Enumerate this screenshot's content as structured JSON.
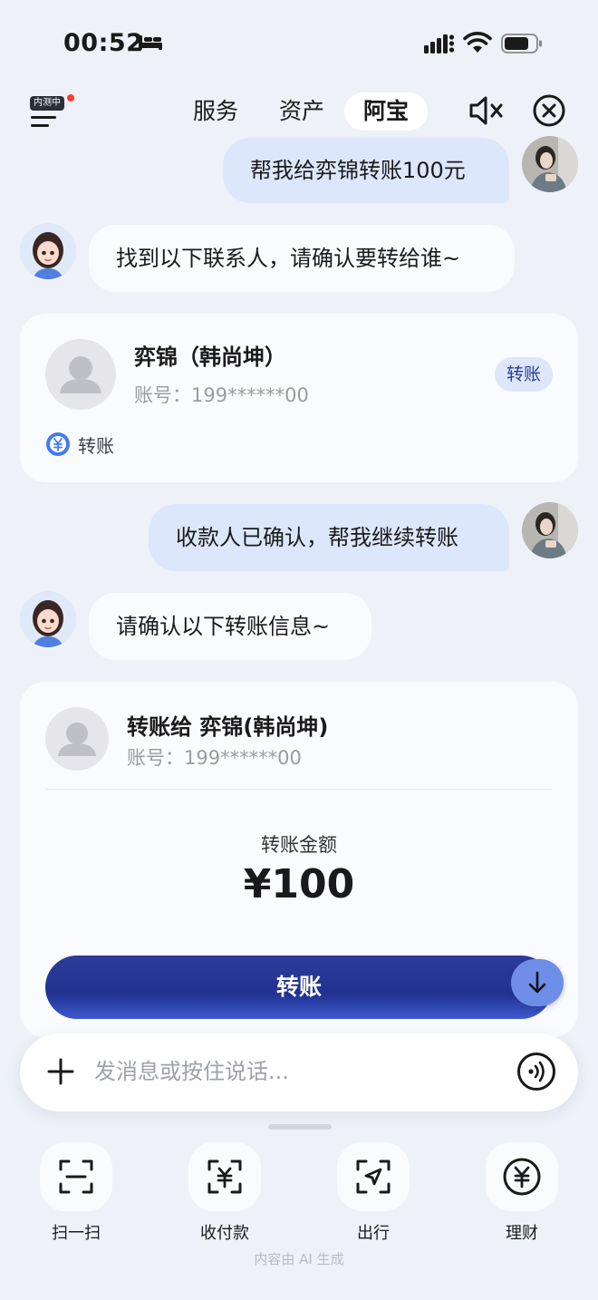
{
  "status_bar": {
    "time": "00:52"
  },
  "nav": {
    "beta_badge": "内测中",
    "tabs": [
      {
        "label": "服务"
      },
      {
        "label": "资产"
      },
      {
        "label": "阿宝",
        "active": true
      }
    ]
  },
  "chat": {
    "messages": [
      {
        "role": "user",
        "text": "帮我给弈锦转账100元"
      },
      {
        "role": "bot",
        "text": "找到以下联系人，请确认要转给谁~"
      },
      {
        "role": "user",
        "text": "收款人已确认，帮我继续转账"
      },
      {
        "role": "bot",
        "text": "请确认以下转账信息~"
      }
    ],
    "contact_card": {
      "name": "弈锦（韩尚坤）",
      "account": "账号：199******00",
      "action_label": "转账",
      "service_label": "转账"
    },
    "confirm_card": {
      "recipient": "转账给 弈锦(韩尚坤)",
      "account": "账号：199******00",
      "amount_label": "转账金额",
      "amount": "¥100",
      "button_label": "转账"
    }
  },
  "input": {
    "placeholder": "发消息或按住说话..."
  },
  "quick_actions": [
    {
      "label": "扫一扫",
      "icon": "scan-icon"
    },
    {
      "label": "收付款",
      "icon": "payment-qr-icon"
    },
    {
      "label": "出行",
      "icon": "navigation-icon"
    },
    {
      "label": "理财",
      "icon": "yuan-circle-icon"
    }
  ],
  "footer_note": "内容由 AI 生成",
  "colors": {
    "background": "#eef1f8",
    "user_bubble": "#dde7fb",
    "primary_button": "#203190",
    "tag_bg": "#dde6fb",
    "tag_text": "#2d3d92"
  }
}
